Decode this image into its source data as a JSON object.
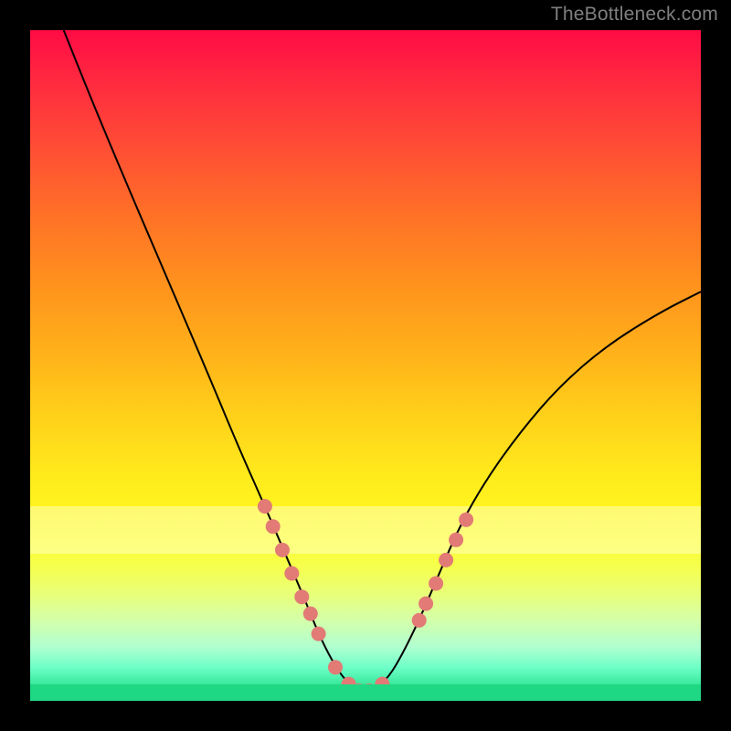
{
  "watermark": "TheBottleneck.com",
  "colors": {
    "background": "#000000",
    "curve": "#000000",
    "markers": "#e27a76",
    "gradient_top": "#ff0b45",
    "gradient_bottom": "#1ed884"
  },
  "chart_data": {
    "type": "line",
    "title": "",
    "xlabel": "",
    "ylabel": "",
    "xlim": [
      0,
      100
    ],
    "ylim": [
      0,
      100
    ],
    "grid": false,
    "legend": false,
    "series": [
      {
        "name": "bottleneck-curve",
        "x": [
          5,
          9,
          14,
          20,
          26,
          31,
          35,
          38,
          41,
          43,
          45,
          47,
          49,
          51,
          53,
          55,
          58,
          61,
          64,
          68,
          73,
          79,
          86,
          94,
          100
        ],
        "y": [
          100,
          90,
          78,
          64,
          50,
          38,
          29,
          22,
          15,
          10,
          6,
          3,
          1.5,
          1.5,
          3,
          6,
          12,
          19,
          26,
          33,
          40,
          47,
          53,
          58,
          61
        ]
      }
    ],
    "markers": {
      "name": "highlighted-points",
      "points": [
        {
          "x": 35.0,
          "y": 29.0
        },
        {
          "x": 36.2,
          "y": 26.0
        },
        {
          "x": 37.6,
          "y": 22.5
        },
        {
          "x": 39.0,
          "y": 19.0
        },
        {
          "x": 40.5,
          "y": 15.5
        },
        {
          "x": 41.8,
          "y": 13.0
        },
        {
          "x": 43.0,
          "y": 10.0
        },
        {
          "x": 45.5,
          "y": 5.0
        },
        {
          "x": 47.5,
          "y": 2.5
        },
        {
          "x": 49.0,
          "y": 1.5
        },
        {
          "x": 50.5,
          "y": 1.5
        },
        {
          "x": 52.5,
          "y": 2.5
        },
        {
          "x": 58.0,
          "y": 12.0
        },
        {
          "x": 59.0,
          "y": 14.5
        },
        {
          "x": 60.5,
          "y": 17.5
        },
        {
          "x": 62.0,
          "y": 21.0
        },
        {
          "x": 63.5,
          "y": 24.0
        },
        {
          "x": 65.0,
          "y": 27.0
        }
      ]
    },
    "bands": [
      {
        "name": "pale-band",
        "y_from": 22,
        "y_to": 29
      }
    ]
  }
}
